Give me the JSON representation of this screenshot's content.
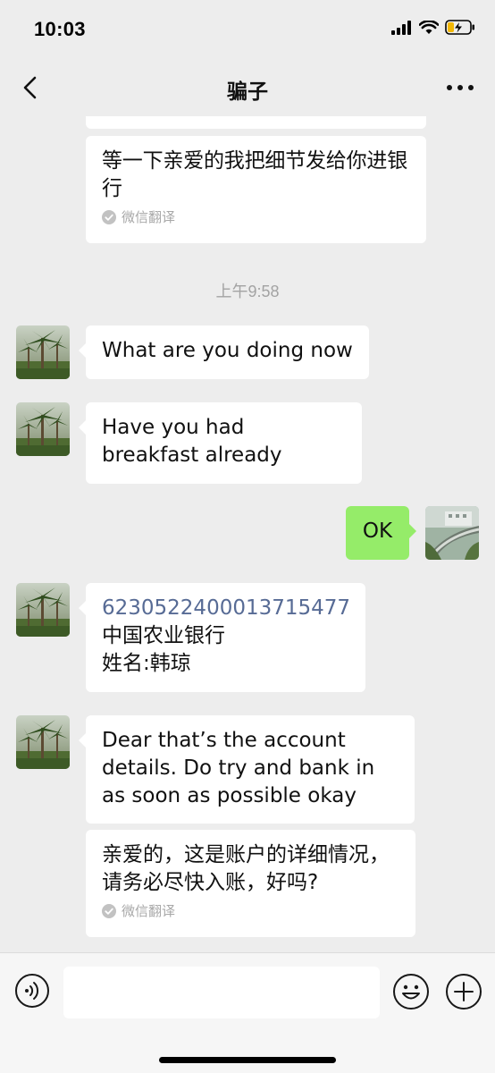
{
  "status_bar": {
    "time": "10:03",
    "icons": [
      "signal-icon",
      "wifi-icon",
      "battery-charging-icon"
    ]
  },
  "nav": {
    "title": "骗子",
    "back_icon": "chevron-left-icon",
    "more_icon": "more-dots-icon"
  },
  "chat": {
    "timestamp": "上午9:58",
    "translation_label": "微信翻译",
    "messages": [
      {
        "side": "incoming",
        "text": "等一下亲爱的我把细节发给你进银行",
        "translated": true
      },
      {
        "side": "incoming",
        "text": "What are you doing now"
      },
      {
        "side": "incoming",
        "text": "Have you had breakfast already"
      },
      {
        "side": "outgoing",
        "text": "OK"
      },
      {
        "side": "incoming",
        "lines": [
          "6230522400013715477",
          "中国农业银行",
          "姓名:韩琼"
        ]
      },
      {
        "side": "incoming",
        "text": "Dear that’s the account details. Do try and bank in as soon as possible okay"
      },
      {
        "side": "incoming",
        "text": "亲爱的，这是账户的详细情况，请务必尽快入账，好吗?",
        "translated": true
      }
    ]
  },
  "input_bar": {
    "value": "",
    "icons": [
      "voice-icon",
      "emoji-icon",
      "plus-icon"
    ]
  },
  "colors": {
    "background": "#ededed",
    "bubble_incoming": "#ffffff",
    "bubble_outgoing": "#95ec69",
    "link": "#576b95"
  }
}
